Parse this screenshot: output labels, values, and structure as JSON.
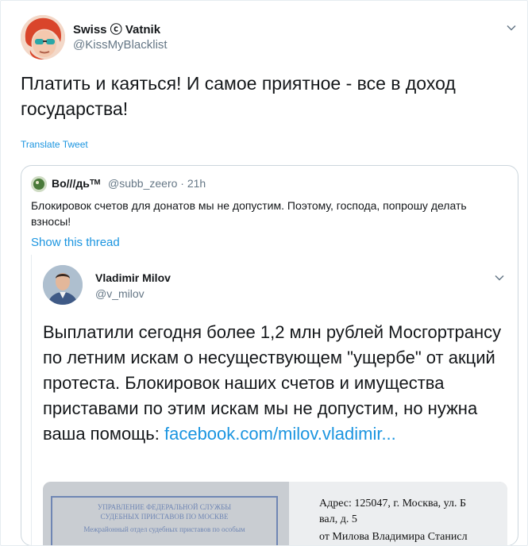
{
  "tweet": {
    "author_name": "Swiss ⓒ Vatnik",
    "author_handle": "@KissMyBlacklist",
    "text": "Платить и каяться! И самое приятное - все в доход государства!",
    "translate_label": "Translate Tweet"
  },
  "quoted": {
    "author_name": "Во///дьᵀᴹ",
    "author_handle": "@subb_zeero",
    "time": "21h",
    "text": "Блокировок счетов для донатов мы не допустим. Поэтому, господа, попрошу делать взносы!",
    "show_thread_label": "Show this thread",
    "inner": {
      "author_name": "Vladimir Milov",
      "author_handle": "@v_milov",
      "text": "Выплатили сегодня более 1,2 млн рублей Мосгортрансу по летним искам о несуществующем \"ущербе\" от акций протеста. Блокировок наших счетов и имущества приставами по этим искам мы не допустим, но нужна ваша помощь:",
      "link": "facebook.com/milov.vladimir...",
      "document": {
        "stamp_line1": "УПРАВЛЕНИЕ ФЕДЕРАЛЬНОЙ СЛУЖБЫ",
        "stamp_line2": "СУДЕБНЫХ ПРИСТАВОВ ПО МОСКВЕ",
        "stamp_line3": "Межрайонный отдел судебных приставов по особым",
        "address_line1": "Адрес: 125047, г. Москва, ул. Б",
        "address_line2": "вал, д. 5",
        "address_line3": "от Милова Владимира Станисл"
      }
    }
  },
  "colors": {
    "link_blue": "#1b95e0",
    "secondary_text": "#657786",
    "border": "#ccd6dd"
  },
  "icons": [
    "chevron-down-icon",
    "copyright-icon"
  ]
}
